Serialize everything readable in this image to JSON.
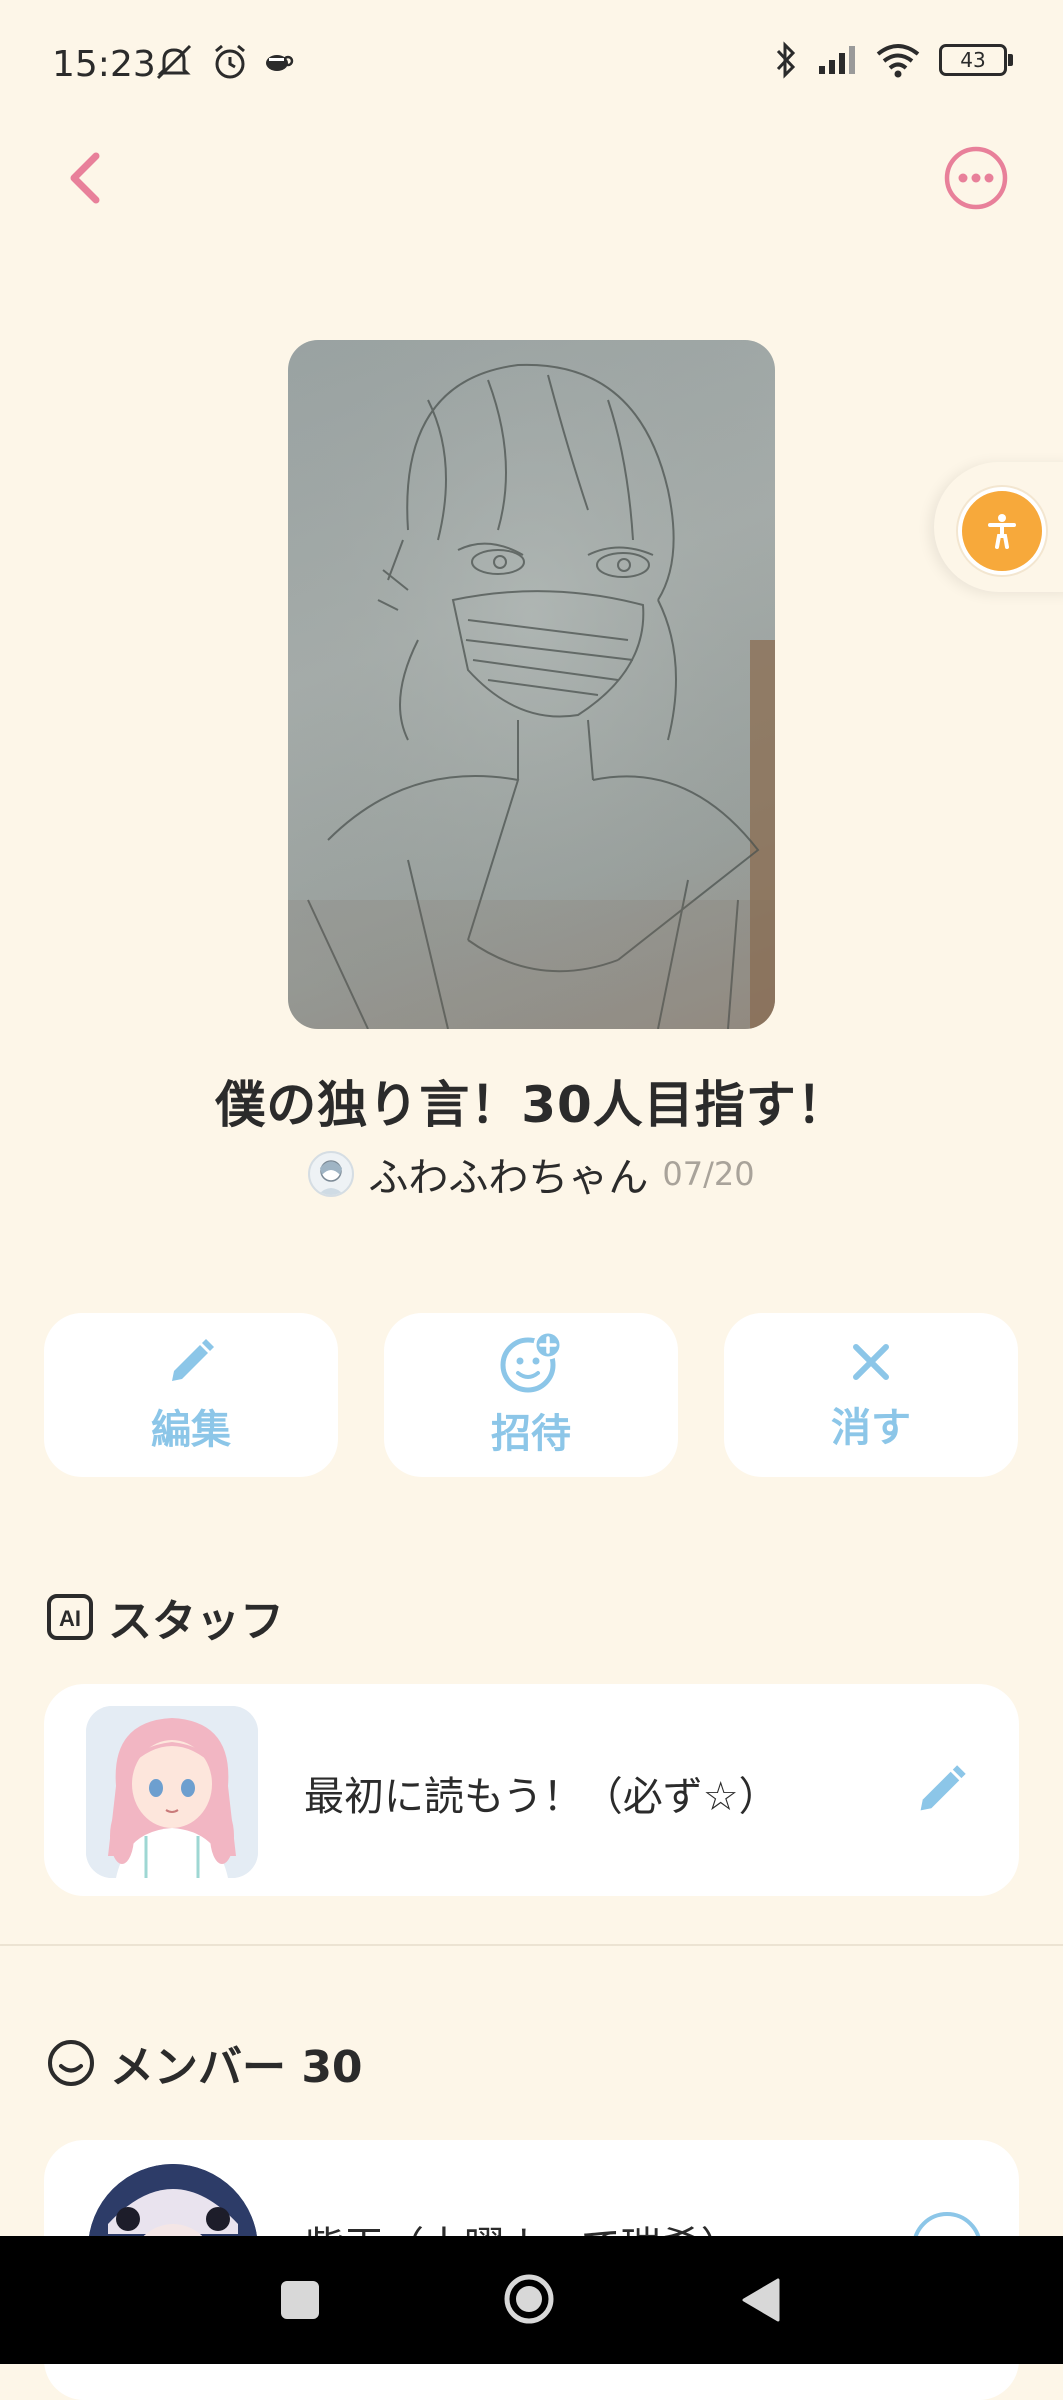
{
  "status_bar": {
    "time": "15:23",
    "battery": "43",
    "icons_left": [
      "mute-icon",
      "alarm-icon",
      "cup-icon"
    ],
    "icons_right": [
      "bluetooth-icon",
      "signal-icon",
      "wifi-icon",
      "battery-icon"
    ]
  },
  "header": {
    "back_icon": "chevron-left-icon",
    "more_icon": "more-horizontal-icon"
  },
  "room": {
    "title": "僕の独り言！30人目指す！",
    "author": "ふわふわちゃん",
    "date": "07/20"
  },
  "actions": [
    {
      "label": "編集",
      "icon": "pencil-icon"
    },
    {
      "label": "招待",
      "icon": "invite-icon"
    },
    {
      "label": "消す",
      "icon": "close-icon"
    }
  ],
  "staff": {
    "section_label": "スタッフ",
    "badge": "AI",
    "item_text": "最初に読もう！（必ず☆）"
  },
  "members": {
    "section_label": "メンバー 30",
    "first_item_text": "紫玉（土曜よって瑞希）"
  },
  "colors": {
    "background": "#fdf6e8",
    "accent_pink": "#e8809a",
    "accent_blue": "#8cc6e8",
    "accessibility_orange": "#f7a93b"
  }
}
